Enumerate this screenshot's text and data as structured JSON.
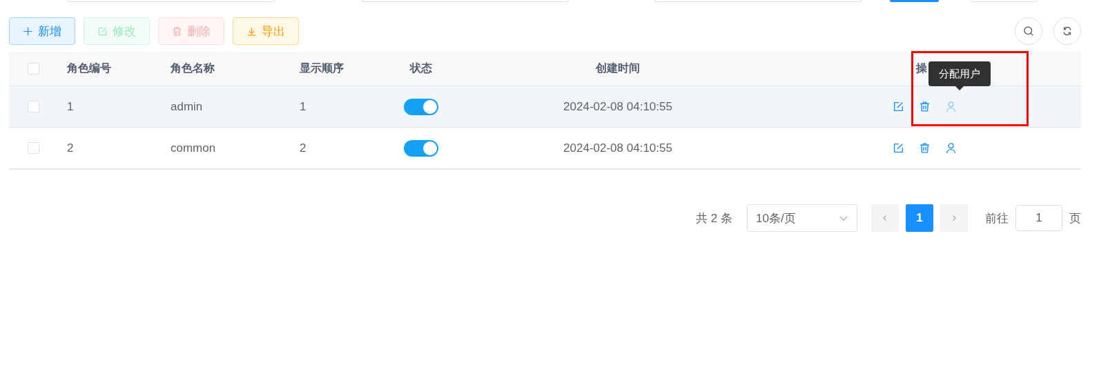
{
  "toolbar": {
    "buttons": [
      {
        "label": "新增",
        "kind": "primary",
        "disabled": false
      },
      {
        "label": "修改",
        "kind": "success",
        "disabled": true
      },
      {
        "label": "删除",
        "kind": "danger",
        "disabled": true
      },
      {
        "label": "导出",
        "kind": "warning",
        "disabled": false
      }
    ]
  },
  "table": {
    "select_all_checked": false,
    "columns": [
      "角色编号",
      "角色名称",
      "显示顺序",
      "状态",
      "创建时间",
      "操"
    ],
    "rows": [
      {
        "checked": false,
        "id": "1",
        "name": "admin",
        "order": "1",
        "status_on": true,
        "created": "2024-02-08 04:10:55",
        "hovered": true
      },
      {
        "checked": false,
        "id": "2",
        "name": "common",
        "order": "2",
        "status_on": true,
        "created": "2024-02-08 04:10:55",
        "hovered": false
      }
    ]
  },
  "tooltip": {
    "text": "分配用户"
  },
  "pagination": {
    "total": "共 2 条",
    "page_size": "10条/页",
    "pages": [
      {
        "label": "1",
        "selected": true
      }
    ],
    "goto_label": "前往",
    "goto_value": "1",
    "page_suffix": "页"
  }
}
